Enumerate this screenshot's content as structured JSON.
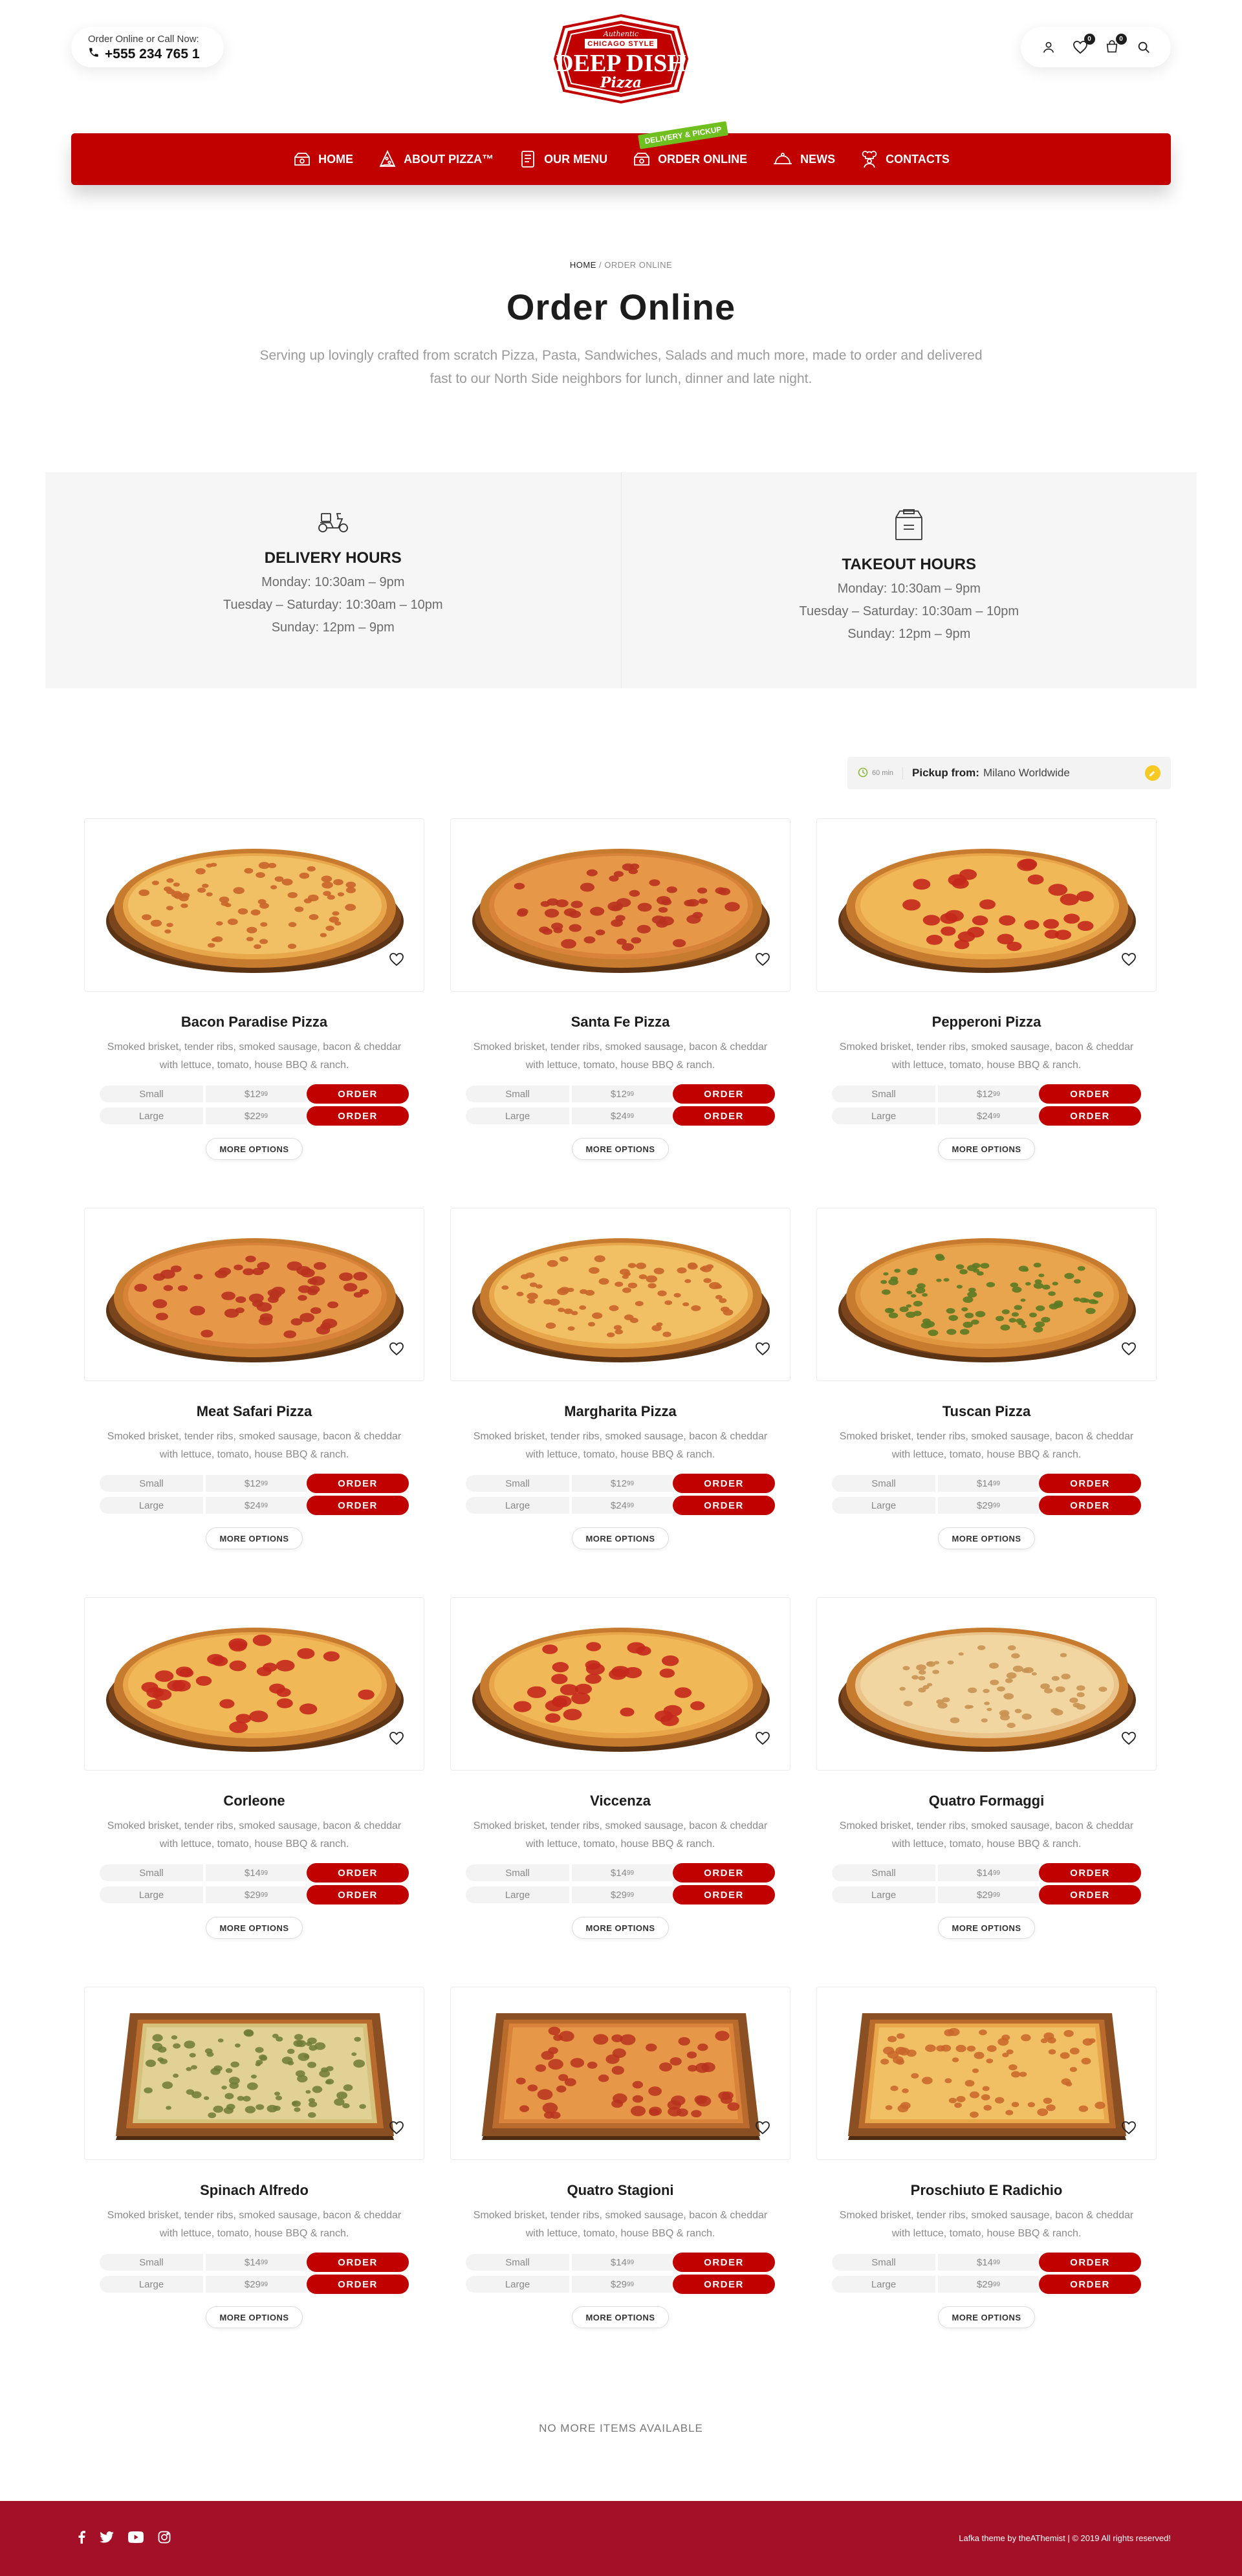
{
  "header": {
    "call_label": "Order Online or Call Now:",
    "phone": "+555 234 765 1",
    "logo": {
      "top_script": "Authentic",
      "ribbon": "CHICAGO STYLE",
      "main": "DEEP DISH",
      "sub": "Pizza"
    },
    "wishlist_count": "0",
    "cart_count": "0",
    "icons": [
      "user-icon",
      "heart-icon",
      "cart-icon",
      "search-icon"
    ]
  },
  "nav": {
    "items": [
      {
        "label": "Home",
        "icon": "pizza-box-icon"
      },
      {
        "label": "About Pizza™",
        "icon": "pizza-slice-icon"
      },
      {
        "label": "Our Menu",
        "icon": "menu-box-icon"
      },
      {
        "label": "Order Online",
        "icon": "pizza-box-icon",
        "tag": "Delivery & Pickup"
      },
      {
        "label": "News",
        "icon": "cloche-icon"
      },
      {
        "label": "Contacts",
        "icon": "chef-icon"
      }
    ],
    "background": "#c10000",
    "tag_color": "#6fbf1f"
  },
  "page": {
    "breadcrumb_home": "Home",
    "breadcrumb_sep": "/",
    "breadcrumb_current": "Order Online",
    "title": "Order Online",
    "intro": "Serving up lovingly crafted from scratch Pizza, Pasta, Sandwiches, Salads and much more, made to order and delivered fast to our North Side neighbors for lunch, dinner and late night."
  },
  "hours": [
    {
      "icon": "scooter-icon",
      "title": "Delivery Hours",
      "lines": [
        "Monday: 10:30am – 9pm",
        "Tuesday – Saturday: 10:30am – 10pm",
        "Sunday: 12pm – 9pm"
      ]
    },
    {
      "icon": "takeout-box-icon",
      "title": "Takeout Hours",
      "lines": [
        "Monday: 10:30am – 9pm",
        "Tuesday – Saturday: 10:30am – 10pm",
        "Sunday: 12pm – 9pm"
      ]
    }
  ],
  "pickup": {
    "time": "60 min",
    "label": "Pickup from:",
    "location": "Milano Worldwide"
  },
  "products": [
    {
      "name": "Bacon Paradise Pizza",
      "desc": "Smoked brisket, tender ribs, smoked sausage, bacon & cheddar with lettuce, tomato, house BBQ & ranch.",
      "shape": "round",
      "style": "cheese",
      "sizes": [
        {
          "name": "Small",
          "price": "$12",
          "cents": "99"
        },
        {
          "name": "Large",
          "price": "$22",
          "cents": "99"
        }
      ]
    },
    {
      "name": "Santa Fe Pizza",
      "desc": "Smoked brisket, tender ribs, smoked sausage, bacon & cheddar with lettuce, tomato, house BBQ & ranch.",
      "shape": "round",
      "style": "meat",
      "sizes": [
        {
          "name": "Small",
          "price": "$12",
          "cents": "99"
        },
        {
          "name": "Large",
          "price": "$24",
          "cents": "99"
        }
      ]
    },
    {
      "name": "Pepperoni Pizza",
      "desc": "Smoked brisket, tender ribs, smoked sausage, bacon & cheddar with lettuce, tomato, house BBQ & ranch.",
      "shape": "round",
      "style": "pepperoni",
      "sizes": [
        {
          "name": "Small",
          "price": "$12",
          "cents": "99"
        },
        {
          "name": "Large",
          "price": "$24",
          "cents": "99"
        }
      ]
    },
    {
      "name": "Meat Safari Pizza",
      "desc": "Smoked brisket, tender ribs, smoked sausage, bacon & cheddar with lettuce, tomato, house BBQ & ranch.",
      "shape": "round",
      "style": "meat",
      "sizes": [
        {
          "name": "Small",
          "price": "$12",
          "cents": "99"
        },
        {
          "name": "Large",
          "price": "$24",
          "cents": "99"
        }
      ]
    },
    {
      "name": "Margharita Pizza",
      "desc": "Smoked brisket, tender ribs, smoked sausage, bacon & cheddar with lettuce, tomato, house BBQ & ranch.",
      "shape": "round",
      "style": "cheese",
      "sizes": [
        {
          "name": "Small",
          "price": "$12",
          "cents": "99"
        },
        {
          "name": "Large",
          "price": "$24",
          "cents": "99"
        }
      ]
    },
    {
      "name": "Tuscan Pizza",
      "desc": "Smoked brisket, tender ribs, smoked sausage, bacon & cheddar with lettuce, tomato, house BBQ & ranch.",
      "shape": "round",
      "style": "veggie",
      "sizes": [
        {
          "name": "Small",
          "price": "$14",
          "cents": "99"
        },
        {
          "name": "Large",
          "price": "$29",
          "cents": "99"
        }
      ]
    },
    {
      "name": "Corleone",
      "desc": "Smoked brisket, tender ribs, smoked sausage, bacon & cheddar with lettuce, tomato, house BBQ & ranch.",
      "shape": "round",
      "style": "pepperoni",
      "sizes": [
        {
          "name": "Small",
          "price": "$14",
          "cents": "99"
        },
        {
          "name": "Large",
          "price": "$29",
          "cents": "99"
        }
      ]
    },
    {
      "name": "Viccenza",
      "desc": "Smoked brisket, tender ribs, smoked sausage, bacon & cheddar with lettuce, tomato, house BBQ & ranch.",
      "shape": "round",
      "style": "pepperoni",
      "sizes": [
        {
          "name": "Small",
          "price": "$14",
          "cents": "99"
        },
        {
          "name": "Large",
          "price": "$29",
          "cents": "99"
        }
      ]
    },
    {
      "name": "Quatro Formaggi",
      "desc": "Smoked brisket, tender ribs, smoked sausage, bacon & cheddar with lettuce, tomato, house BBQ & ranch.",
      "shape": "round",
      "style": "white",
      "sizes": [
        {
          "name": "Small",
          "price": "$14",
          "cents": "99"
        },
        {
          "name": "Large",
          "price": "$29",
          "cents": "99"
        }
      ]
    },
    {
      "name": "Spinach Alfredo",
      "desc": "Smoked brisket, tender ribs, smoked sausage, bacon & cheddar with lettuce, tomato, house BBQ & ranch.",
      "shape": "square",
      "style": "spinach",
      "sizes": [
        {
          "name": "Small",
          "price": "$14",
          "cents": "99"
        },
        {
          "name": "Large",
          "price": "$29",
          "cents": "99"
        }
      ]
    },
    {
      "name": "Quatro Stagioni",
      "desc": "Smoked brisket, tender ribs, smoked sausage, bacon & cheddar with lettuce, tomato, house BBQ & ranch.",
      "shape": "square",
      "style": "meat",
      "sizes": [
        {
          "name": "Small",
          "price": "$14",
          "cents": "99"
        },
        {
          "name": "Large",
          "price": "$29",
          "cents": "99"
        }
      ]
    },
    {
      "name": "Proschiuto E Radichio",
      "desc": "Smoked brisket, tender ribs, smoked sausage, bacon & cheddar with lettuce, tomato, house BBQ & ranch.",
      "shape": "square",
      "style": "cheese",
      "sizes": [
        {
          "name": "Small",
          "price": "$14",
          "cents": "99"
        },
        {
          "name": "Large",
          "price": "$29",
          "cents": "99"
        }
      ]
    }
  ],
  "buttons": {
    "order": "Order",
    "more_options": "More Options"
  },
  "no_more": "No more items available",
  "footer": {
    "social": [
      "facebook-icon",
      "twitter-icon",
      "youtube-icon",
      "instagram-icon"
    ],
    "copyright": "Lafka theme by theAThemist | © 2019 All rights reserved!",
    "background": "#a31027"
  }
}
